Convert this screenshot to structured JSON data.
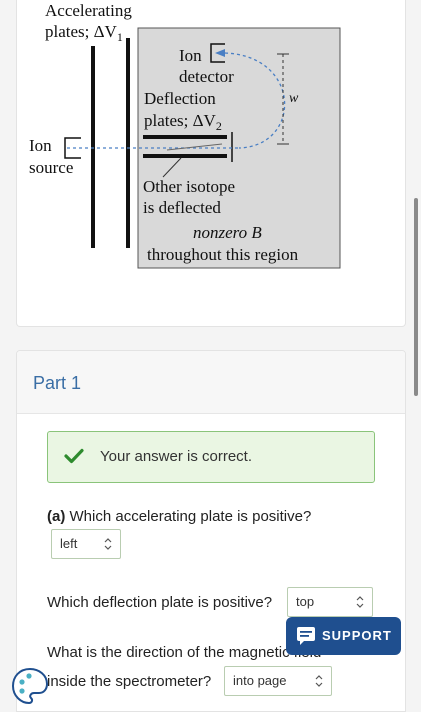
{
  "figure": {
    "accelerating_label_line1": "Accelerating",
    "accelerating_label_line2": "plates; ΔV",
    "accelerating_sub": "1",
    "ion_detector_line1": "Ion",
    "ion_detector_line2": "detector",
    "deflection_line1": "Deflection",
    "deflection_line2": "plates; ΔV",
    "deflection_sub": "2",
    "w_label": "w",
    "ion_source_line1": "Ion",
    "ion_source_line2": "source",
    "isotope_line1": "Other isotope",
    "isotope_line2": "is deflected",
    "field_line1": "nonzero B",
    "field_line2": "throughout this region"
  },
  "part": {
    "title": "Part 1",
    "correct_message": "Your answer is correct.",
    "q_a_prefix": "(a)",
    "q_a_text": " Which accelerating plate is positive?",
    "q_a_answer": "left",
    "q_b_text": "Which deflection plate is positive?",
    "q_b_answer": "top",
    "q_c_line1": "What is the direction of the magnetic field",
    "q_c_line2": "inside the spectrometer?",
    "q_c_answer": "into page"
  },
  "support_label": "SUPPORT",
  "colors": {
    "accent": "#3a6ea5",
    "success_bg": "#eaf6e3",
    "success_border": "#8ac47a",
    "check": "#2e8b2e",
    "support_bg": "#1f4f8f",
    "beam": "#4a7fc4"
  }
}
